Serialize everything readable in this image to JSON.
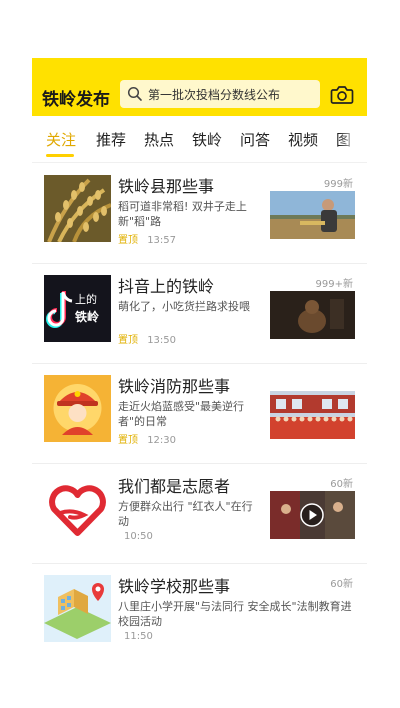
{
  "header": {
    "logo": "铁岭发布",
    "search_placeholder": "第一批次投档分数线公布",
    "search_icon": "search-icon",
    "camera_icon": "camera-icon",
    "bg_color": "#ffe100"
  },
  "tabs": [
    {
      "label": "关注",
      "active": true
    },
    {
      "label": "推荐"
    },
    {
      "label": "热点"
    },
    {
      "label": "铁岭"
    },
    {
      "label": "问答"
    },
    {
      "label": "视频"
    },
    {
      "label": "图"
    }
  ],
  "feed": [
    {
      "title": "铁岭县那些事",
      "count": "999新",
      "desc": "稻可道非常稻! 双井子走上新\"稻\"路",
      "badge": "置顶",
      "time": "13:57"
    },
    {
      "title": "抖音上的铁岭",
      "count": "999+新",
      "desc": "萌化了，小吃货拦路求投喂",
      "badge": "置顶",
      "time": "13:50",
      "thumb_text_top": "上的",
      "thumb_text_bottom": "铁岭"
    },
    {
      "title": "铁岭消防那些事",
      "count": "",
      "desc": "走近火焰蓝感受\"最美逆行者\"的日常",
      "badge": "置顶",
      "time": "12:30"
    },
    {
      "title": "我们都是志愿者",
      "count": "60新",
      "desc": "方便群众出行 \"红衣人\"在行动",
      "badge": "",
      "time": "10:50"
    },
    {
      "title": "铁岭学校那些事",
      "count": "60新",
      "desc": "八里庄小学开展\"与法同行 安全成长\"法制教育进校园活动",
      "badge": "",
      "time": "11:50"
    }
  ]
}
